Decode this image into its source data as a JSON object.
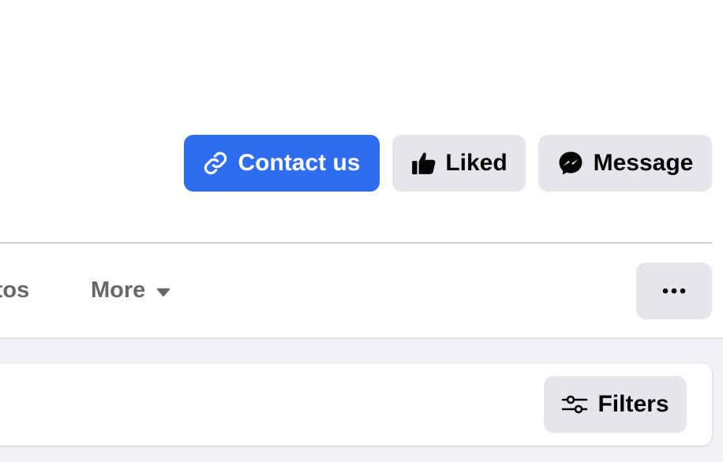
{
  "actions": {
    "contact_label": "Contact us",
    "liked_label": "Liked",
    "message_label": "Message"
  },
  "tabs": {
    "photos_label": "otos",
    "more_label": "More"
  },
  "filters": {
    "label": "Filters"
  },
  "colors": {
    "primary": "#2e6cf0",
    "secondary_button": "#e4e6eb",
    "tab_text": "#65676b",
    "text": "#050505",
    "background_alt": "#f0f2f5"
  },
  "icons": {
    "contact": "link-icon",
    "liked": "thumbs-up-icon",
    "message": "messenger-icon",
    "more": "caret-down-icon",
    "options": "more-dots-icon",
    "filters": "sliders-icon"
  }
}
